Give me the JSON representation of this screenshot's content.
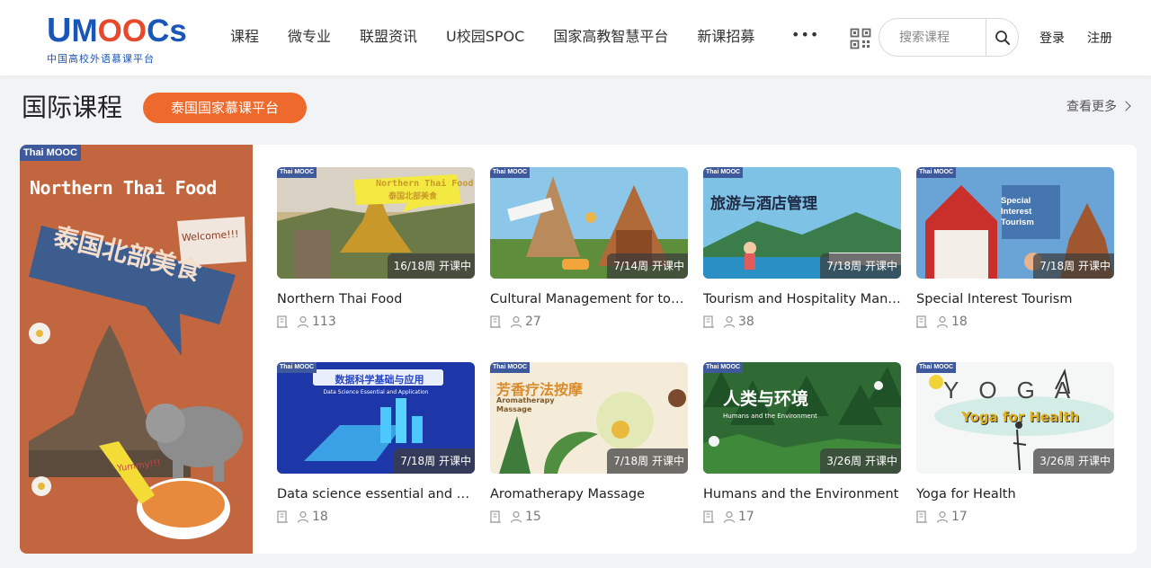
{
  "logo": {
    "u": "U",
    "m": "M",
    "oo": "OO",
    "cs": "Cs",
    "subtitle": "中国高校外语慕课平台"
  },
  "nav": {
    "items": [
      "课程",
      "微专业",
      "联盟资讯",
      "U校园SPOC",
      "国家高教智慧平台",
      "新课招募"
    ],
    "more": "•••"
  },
  "search": {
    "placeholder": "搜索课程"
  },
  "auth": {
    "login": "登录",
    "register": "注册"
  },
  "section": {
    "title": "国际课程",
    "platform_button": "泰国国家慕课平台",
    "view_more": "查看更多"
  },
  "banner": {
    "tag": "Thai MOOC",
    "title_en": "Northern Thai Food",
    "title_cn": "泰国北部美食",
    "welcome": "Welcome!!!",
    "yummy": "Yummy!!!"
  },
  "thumb_tag": "Thai MOOC",
  "courses": [
    {
      "title": "Northern Thai Food",
      "badge": "16/18周 开课中",
      "learners": "113",
      "thumb_text": "Northern Thai Food",
      "thumb_sub": "泰国北部美食"
    },
    {
      "title": "Cultural Management for touri...",
      "badge": "7/14周 开课中",
      "learners": "27"
    },
    {
      "title": "Tourism and Hospitality Mana...",
      "badge": "7/18周 开课中",
      "learners": "38",
      "thumb_text": "旅游与酒店管理"
    },
    {
      "title": "Special Interest Tourism",
      "badge": "7/18周 开课中",
      "learners": "18",
      "thumb_text": "Special Interest Tourism"
    },
    {
      "title": "Data science essential and ap...",
      "badge": "7/18周 开课中",
      "learners": "18",
      "thumb_text": "数据科学基础与应用",
      "thumb_sub": "Data Science Essential and Application"
    },
    {
      "title": "Aromatherapy Massage",
      "badge": "7/18周 开课中",
      "learners": "15",
      "thumb_text": "芳香疗法按摩",
      "thumb_sub": "Aromatherapy Massage"
    },
    {
      "title": "Humans and the Environment",
      "badge": "3/26周 开课中",
      "learners": "17",
      "thumb_text": "人类与环境",
      "thumb_sub": "Humans and the Environment"
    },
    {
      "title": "Yoga for Health",
      "badge": "3/26周 开课中",
      "learners": "17",
      "thumb_text": "Yoga for Health",
      "thumb_sub": "YOGA"
    }
  ]
}
